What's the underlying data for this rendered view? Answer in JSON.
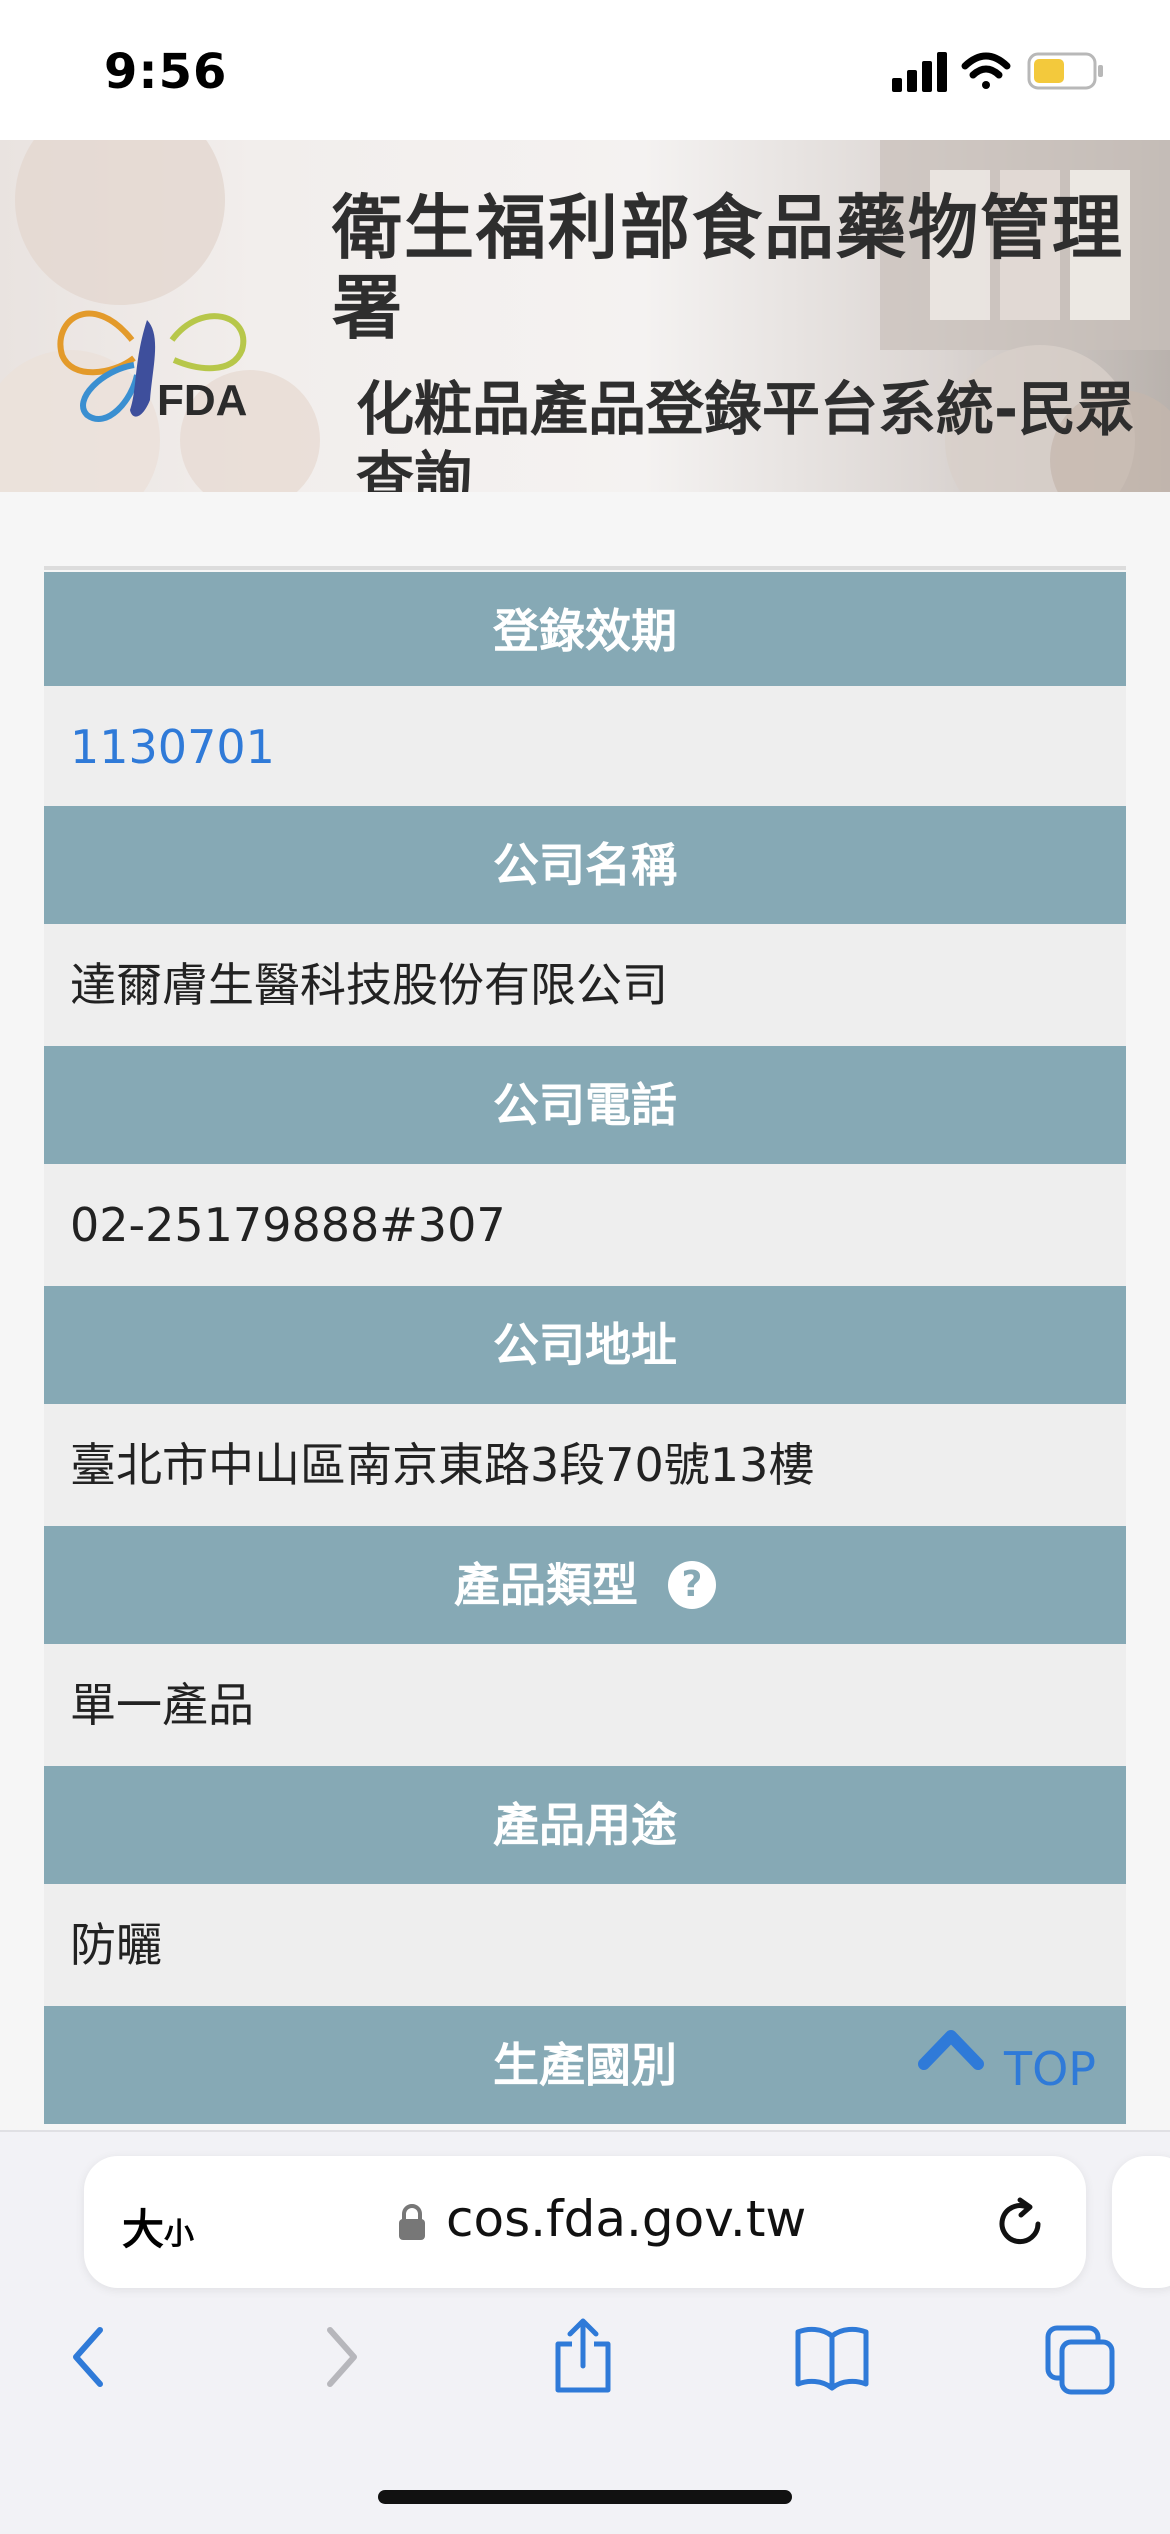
{
  "status_bar": {
    "time": "9:56"
  },
  "header": {
    "logo_text": "FDA",
    "agency_name": "衛生福利部食品藥物管理署",
    "system_name": "化粧品產品登錄平台系統-民眾查詢"
  },
  "table": {
    "rows": [
      {
        "label": "登錄效期",
        "value": "1130701"
      },
      {
        "label": "公司名稱",
        "value": "達爾膚生醫科技股份有限公司"
      },
      {
        "label": "公司電話",
        "value": "02-25179888#307"
      },
      {
        "label": "公司地址",
        "value": "臺北市中山區南京東路3段70號13樓"
      },
      {
        "label": "產品類型",
        "value": "單一產品"
      },
      {
        "label": "產品用途",
        "value": "防曬"
      },
      {
        "label": "生產國別",
        "value": ""
      }
    ]
  },
  "top_button": {
    "label": "TOP"
  },
  "browser": {
    "text_size_big": "大",
    "text_size_small": "小",
    "url": "cos.fda.gov.tw"
  }
}
